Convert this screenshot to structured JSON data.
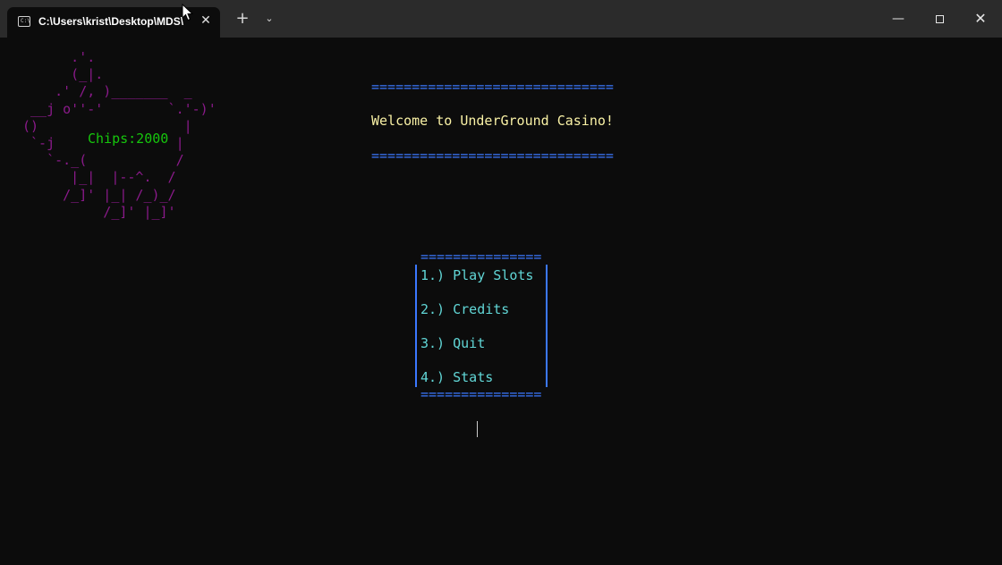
{
  "tab": {
    "title": "C:\\Users\\krist\\Desktop\\MDS\\",
    "icon": "terminal-icon",
    "icon_text": "C:\\",
    "close_symbol": "✕"
  },
  "tab_actions": {
    "new_tab_symbol": "+",
    "dropdown_symbol": "⌄"
  },
  "window_controls": {
    "minimize_symbol": "—",
    "close_symbol": "✕"
  },
  "colors": {
    "background": "#0c0c0c",
    "ascii_art": "#8b1a8b",
    "chips": "#16c60c",
    "rules": "#3b78ff",
    "welcome": "#f9f1a5",
    "menu": "#61d6d6"
  },
  "ascii_art": "      .'.\n      (_|.\n    .' /, )_______  _\n __j o''-'        `.'-)'\n()                  |\n `-j               |\n   `-._(           /\n      |_|  |--^.  /\n     /_]' |_| /_)_/\n          /_]' |_]'",
  "chips": "Chips:2000",
  "banner": {
    "rule": "==============================",
    "welcome": "Welcome to UnderGround Casino!"
  },
  "menu": {
    "rule": "===============",
    "items": [
      "1.) Play Slots",
      "2.) Credits",
      "3.) Quit",
      "4.) Stats"
    ]
  }
}
